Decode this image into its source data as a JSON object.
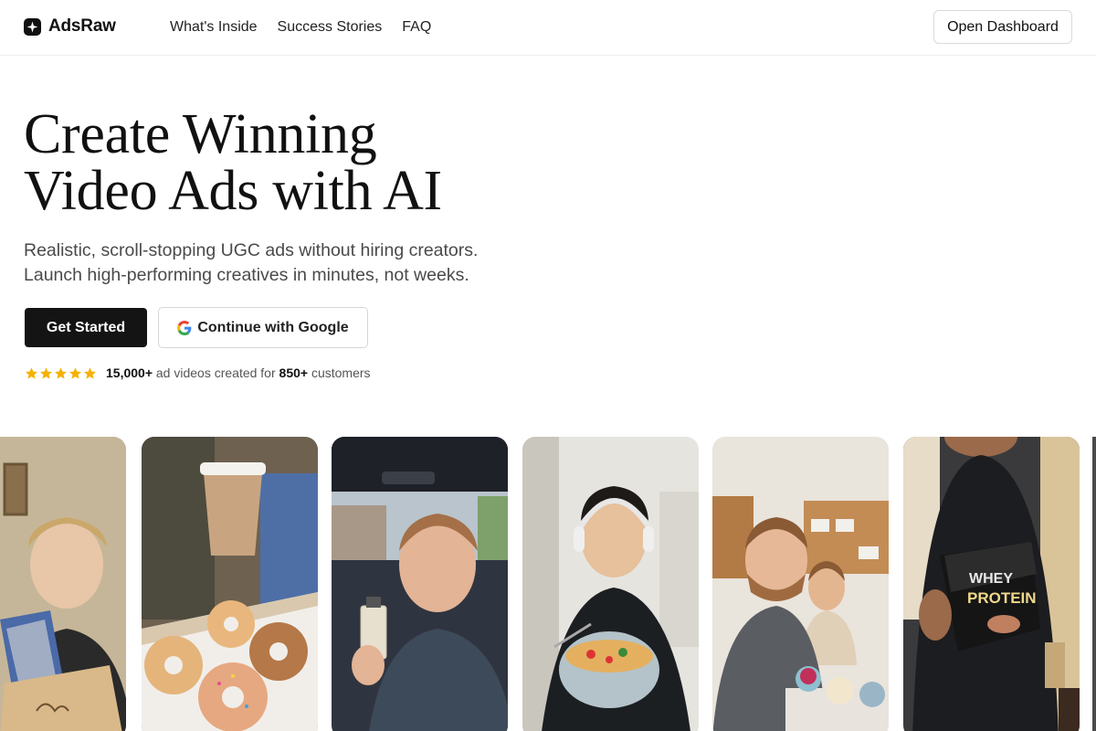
{
  "brand": {
    "name": "AdsRaw",
    "icon": "sparkle-icon"
  },
  "nav": {
    "links": [
      "What's Inside",
      "Success Stories",
      "FAQ"
    ],
    "dashboard_label": "Open Dashboard"
  },
  "hero": {
    "title_lines": [
      "Create Winning",
      "Video Ads with AI"
    ],
    "subtitle_lines": [
      "Realistic, scroll-stopping UGC ads without hiring creators.",
      "Launch high-performing creatives in minutes, not weeks."
    ],
    "primary_label": "Get Started",
    "google_label": "Continue with Google",
    "google_icon": "google-g-icon"
  },
  "rating": {
    "stars": 5,
    "star_color": "#f5b100",
    "videos": "15,000+",
    "middle": "ad videos created for",
    "customers": "850+",
    "end": "customers"
  },
  "cards": [
    {
      "name": "woman-holding-fabric-bag",
      "bg": "#c9b9a0"
    },
    {
      "name": "coffee-and-donuts",
      "bg": "#7b6a58"
    },
    {
      "name": "man-in-car-with-perfume",
      "bg": "#3f4a56"
    },
    {
      "name": "man-with-headphones-eating-pasta",
      "bg": "#d6d4cf"
    },
    {
      "name": "couple-in-kitchen",
      "bg": "#c8a884"
    },
    {
      "name": "man-holding-whey-protein",
      "bg": "#2a2d33"
    }
  ],
  "colors": {
    "text": "#111111",
    "muted": "#4a4a4a",
    "primary_button": "#141414"
  }
}
